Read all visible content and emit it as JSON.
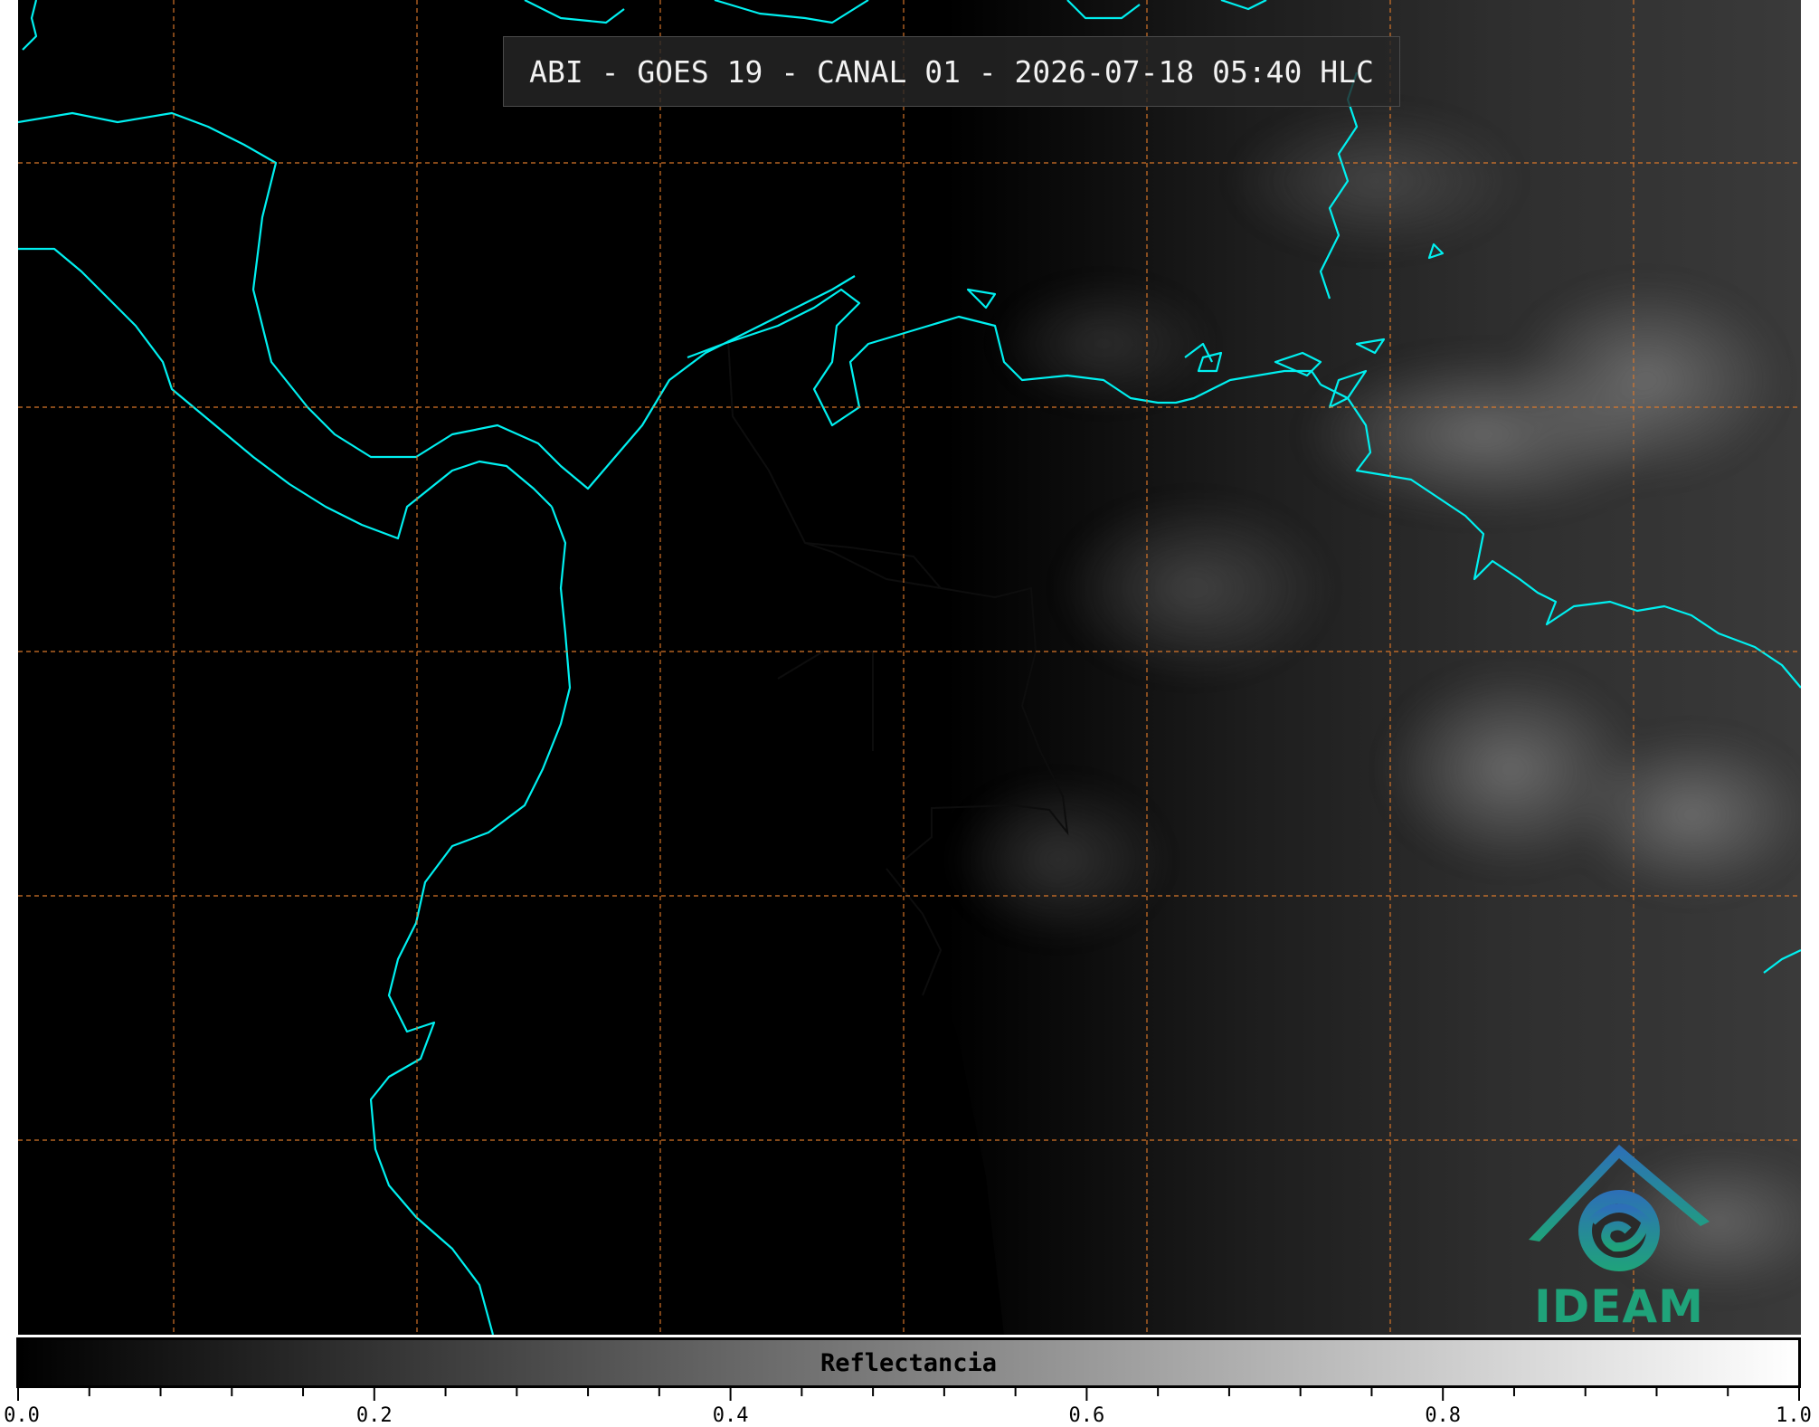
{
  "title": "ABI - GOES 19 - CANAL 01 - 2026-07-18 05:40 HLC",
  "logo": {
    "text": "IDEAM",
    "icon": "ideam-logo-icon",
    "colors": [
      "#2d6fb8",
      "#1fa37a"
    ]
  },
  "colorbar": {
    "label": "Reflectancia",
    "min": 0.0,
    "max": 1.0,
    "ticks": [
      "0.0",
      "0.2",
      "0.4",
      "0.6",
      "0.8",
      "1.0"
    ],
    "minor_ticks_per_major": 4,
    "colormap": [
      "#000000",
      "#ffffff"
    ]
  },
  "map": {
    "coastline_color": "#00f0f0",
    "border_color": "#111111",
    "gridline_color": "#e07a2a",
    "gridline_style": "dashed",
    "graticule_columns": 7,
    "graticule_rows": 5
  }
}
